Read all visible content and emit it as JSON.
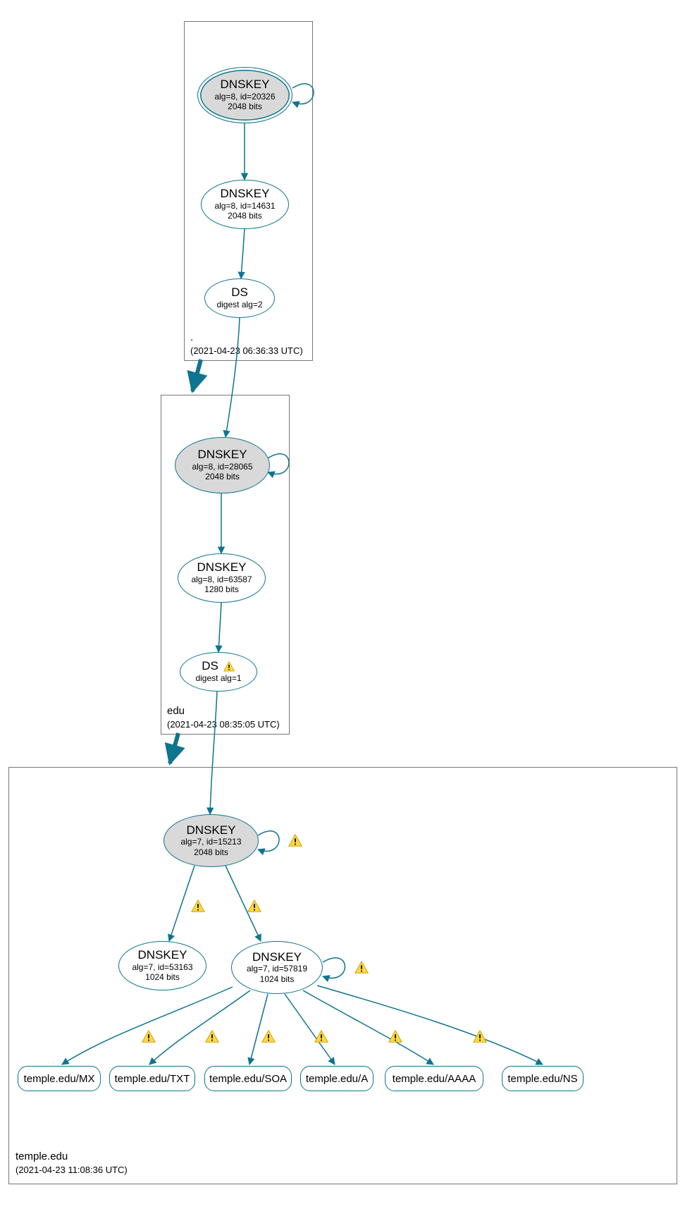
{
  "chart_data": {
    "type": "dnssec-chain",
    "zones": [
      {
        "id": "root",
        "name": ".",
        "timestamp": "(2021-04-23 06:36:33 UTC)"
      },
      {
        "id": "edu",
        "name": "edu",
        "timestamp": "(2021-04-23 08:35:05 UTC)"
      },
      {
        "id": "temple",
        "name": "temple.edu",
        "timestamp": "(2021-04-23 11:08:36 UTC)"
      }
    ],
    "nodes": {
      "root_ksk": {
        "title": "DNSKEY",
        "line2": "alg=8, id=20326",
        "line3": "2048 bits"
      },
      "root_zsk": {
        "title": "DNSKEY",
        "line2": "alg=8, id=14631",
        "line3": "2048 bits"
      },
      "root_ds": {
        "title": "DS",
        "line2": "digest alg=2"
      },
      "edu_ksk": {
        "title": "DNSKEY",
        "line2": "alg=8, id=28065",
        "line3": "2048 bits"
      },
      "edu_zsk": {
        "title": "DNSKEY",
        "line2": "alg=8, id=63587",
        "line3": "1280 bits"
      },
      "edu_ds": {
        "title": "DS",
        "line2": "digest alg=1",
        "warning": true
      },
      "temple_ksk": {
        "title": "DNSKEY",
        "line2": "alg=7, id=15213",
        "line3": "2048 bits"
      },
      "temple_zsk1": {
        "title": "DNSKEY",
        "line2": "alg=7, id=53163",
        "line3": "1024 bits"
      },
      "temple_zsk2": {
        "title": "DNSKEY",
        "line2": "alg=7, id=57819",
        "line3": "1024 bits"
      }
    },
    "rrsets": {
      "mx": {
        "label": "temple.edu/MX"
      },
      "txt": {
        "label": "temple.edu/TXT"
      },
      "soa": {
        "label": "temple.edu/SOA"
      },
      "a": {
        "label": "temple.edu/A"
      },
      "aaaa": {
        "label": "temple.edu/AAAA"
      },
      "ns": {
        "label": "temple.edu/NS"
      }
    },
    "edges": [
      {
        "from": "root_ksk",
        "to": "root_ksk",
        "self": true
      },
      {
        "from": "root_ksk",
        "to": "root_zsk"
      },
      {
        "from": "root_zsk",
        "to": "root_ds"
      },
      {
        "from": "root_ds",
        "to": "edu_ksk"
      },
      {
        "from": "root_zone",
        "to": "edu_zone",
        "delegation": true
      },
      {
        "from": "edu_ksk",
        "to": "edu_ksk",
        "self": true
      },
      {
        "from": "edu_ksk",
        "to": "edu_zsk"
      },
      {
        "from": "edu_zsk",
        "to": "edu_ds"
      },
      {
        "from": "edu_ds",
        "to": "temple_ksk"
      },
      {
        "from": "edu_zone",
        "to": "temple_zone",
        "delegation": true
      },
      {
        "from": "temple_ksk",
        "to": "temple_ksk",
        "self": true,
        "warning": true
      },
      {
        "from": "temple_ksk",
        "to": "temple_zsk1",
        "warning": true
      },
      {
        "from": "temple_ksk",
        "to": "temple_zsk2",
        "warning": true
      },
      {
        "from": "temple_zsk2",
        "to": "temple_zsk2",
        "self": true,
        "warning": true
      },
      {
        "from": "temple_zsk2",
        "to": "mx",
        "warning": true
      },
      {
        "from": "temple_zsk2",
        "to": "txt",
        "warning": true
      },
      {
        "from": "temple_zsk2",
        "to": "soa",
        "warning": true
      },
      {
        "from": "temple_zsk2",
        "to": "a",
        "warning": true
      },
      {
        "from": "temple_zsk2",
        "to": "aaaa",
        "warning": true
      },
      {
        "from": "temple_zsk2",
        "to": "ns",
        "warning": true
      }
    ]
  }
}
